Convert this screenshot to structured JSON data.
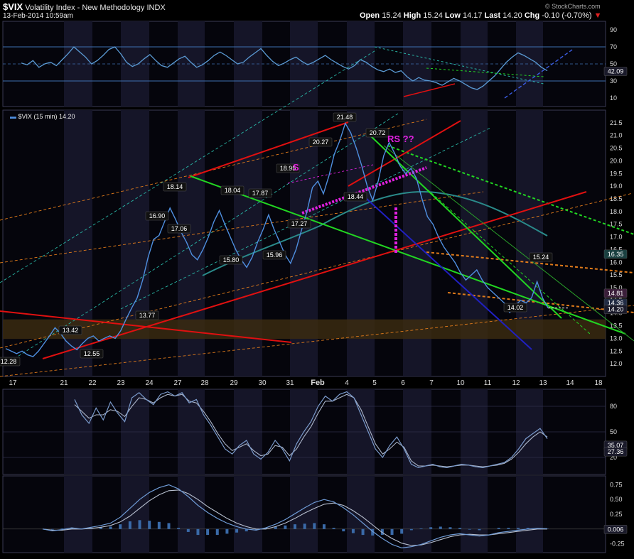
{
  "header": {
    "symbol": "$VIX",
    "name": "Volatility Index - New Methodology",
    "exchange": "INDX",
    "timestamp": "13-Feb-2014 10:59am",
    "open_label": "Open",
    "open": "15.24",
    "high_label": "High",
    "high": "15.24",
    "low_label": "Low",
    "low": "14.17",
    "last_label": "Last",
    "last": "14.20",
    "chg_label": "Chg",
    "chg": "-0.10 (-0.70%)",
    "watermark": "© StockCharts.com",
    "legend": "$VIX (15 min) 14.20"
  },
  "colors": {
    "background": "#000000",
    "panel_band": "#151528",
    "price": "#4f8fe0",
    "rsi": "#5b9bd5",
    "red_trend": "#e01010",
    "green_trend": "#22d622",
    "dash_cyan": "#29b5a5",
    "dash_orange": "#e07b1b",
    "magenta": "#e020e0",
    "blue_line": "#2020c0",
    "teal_ma": "#2a8a8a",
    "support_zone": "#3a2a10"
  },
  "chart_data": [
    {
      "type": "line",
      "panel": "RSI",
      "y_ticks": [
        "90",
        "70",
        "50",
        "30",
        "10"
      ],
      "ylim": [
        0,
        100
      ],
      "last_value_label": "42.09",
      "series": [
        {
          "values": [
            51,
            49,
            54,
            46,
            50,
            52,
            48,
            55,
            62,
            70,
            64,
            58,
            50,
            54,
            60,
            67,
            70,
            62,
            52,
            47,
            50,
            56,
            61,
            54,
            48,
            46,
            51,
            56,
            59,
            52,
            46,
            49,
            54,
            60,
            64,
            60,
            55,
            50,
            52,
            58,
            63,
            68,
            60,
            53,
            48,
            51,
            55,
            58,
            53,
            49,
            52,
            56,
            60,
            55,
            51,
            47,
            44,
            48,
            55,
            52,
            47,
            43,
            41,
            44,
            40,
            42,
            35,
            30,
            34,
            31,
            30,
            28,
            25,
            29,
            33,
            30,
            26,
            22,
            20,
            24,
            30,
            36,
            44,
            52,
            58,
            63,
            60,
            56,
            52,
            46,
            42
          ]
        }
      ]
    },
    {
      "type": "line",
      "panel": "Price",
      "title": "$VIX (15 min) 14.20",
      "ylim": [
        11.5,
        22.0
      ],
      "y_ticks": [
        "21.5",
        "21.0",
        "20.5",
        "20.0",
        "19.5",
        "19.0",
        "18.5",
        "18.0",
        "17.5",
        "17.0",
        "16.5",
        "16.0",
        "15.5",
        "15.0",
        "14.5",
        "14.0",
        "13.5",
        "13.0",
        "12.5",
        "12.0"
      ],
      "x_ticks": [
        "17",
        "21",
        "22",
        "23",
        "24",
        "27",
        "28",
        "29",
        "30",
        "31",
        "Feb",
        "4",
        "5",
        "6",
        "7",
        "10",
        "11",
        "12",
        "13",
        "14",
        "18"
      ],
      "series": [
        {
          "values": [
            12.6,
            12.5,
            12.4,
            12.5,
            12.35,
            12.28,
            12.5,
            12.8,
            13.1,
            13.42,
            13.2,
            12.9,
            12.7,
            12.55,
            12.8,
            13.0,
            13.1,
            12.9,
            13.0,
            13.1,
            13.0,
            13.3,
            13.77,
            14.2,
            14.6,
            15.3,
            16.2,
            16.9,
            17.06,
            17.6,
            18.14,
            17.7,
            17.2,
            16.8,
            16.3,
            16.1,
            16.5,
            17.0,
            17.6,
            18.04,
            17.5,
            17.0,
            16.5,
            16.1,
            15.8,
            16.2,
            16.8,
            17.3,
            17.87,
            17.3,
            16.8,
            16.3,
            15.96,
            16.5,
            17.27,
            18.0,
            18.95,
            19.2,
            18.7,
            19.4,
            20.27,
            20.8,
            21.48,
            21.1,
            20.5,
            19.8,
            19.0,
            18.44,
            19.2,
            20.2,
            20.72,
            20.3,
            19.8,
            19.5,
            19.7,
            19.3,
            18.5,
            17.8,
            17.5,
            17.0,
            16.6,
            16.3,
            16.0,
            15.6,
            15.3,
            15.5,
            15.7,
            15.3,
            15.0,
            14.8,
            14.6,
            14.4,
            14.02,
            14.3,
            14.5,
            14.4,
            14.6,
            15.24,
            14.6,
            14.2
          ]
        }
      ],
      "annotations": [
        "21.48",
        "20.72",
        "20.27",
        "18.95",
        "18.44",
        "18.14",
        "18.04",
        "17.87",
        "17.27",
        "17.06",
        "16.90",
        "15.96",
        "15.80",
        "15.24",
        "14.02",
        "13.77",
        "13.42",
        "12.55",
        "12.28",
        "RS ??",
        "S"
      ],
      "last_value_labels": [
        "14.81",
        "14.36",
        "14.20",
        "16.35"
      ]
    },
    {
      "type": "line",
      "panel": "Stochastic",
      "y_ticks": [
        "80",
        "50",
        "20"
      ],
      "ylim": [
        0,
        100
      ],
      "last_value_labels": [
        "35.07",
        "27.36"
      ],
      "series": [
        {
          "values": [
            88,
            70,
            60,
            78,
            64,
            85,
            72,
            62,
            90,
            96,
            88,
            82,
            94,
            97,
            92,
            96,
            84,
            88,
            70,
            58,
            44,
            30,
            24,
            34,
            40,
            24,
            18,
            26,
            40,
            30,
            16,
            36,
            50,
            62,
            80,
            92,
            86,
            94,
            97,
            90,
            70,
            50,
            30,
            20,
            34,
            44,
            30,
            12,
            8,
            10,
            12,
            9,
            8,
            10,
            12,
            11,
            9,
            8,
            10,
            12,
            14,
            20,
            30,
            42,
            48,
            54,
            42
          ]
        },
        {
          "values": [
            82,
            74,
            66,
            70,
            70,
            76,
            74,
            68,
            80,
            90,
            88,
            84,
            90,
            94,
            92,
            94,
            86,
            84,
            74,
            62,
            48,
            36,
            28,
            32,
            36,
            28,
            22,
            24,
            34,
            32,
            22,
            30,
            44,
            56,
            72,
            86,
            86,
            90,
            94,
            90,
            76,
            56,
            36,
            24,
            30,
            38,
            32,
            16,
            10,
            10,
            11,
            10,
            9,
            10,
            11,
            11,
            10,
            9,
            10,
            11,
            13,
            18,
            26,
            36,
            44,
            50,
            44
          ]
        }
      ]
    },
    {
      "type": "line",
      "panel": "MACD",
      "y_ticks": [
        "0.75",
        "0.50",
        "0.25",
        "-0.25"
      ],
      "ylim": [
        -0.4,
        0.9
      ],
      "last_value_label": "0.006",
      "series": [
        {
          "values": [
            0.0,
            -0.03,
            -0.01,
            0.02,
            0.0,
            0.03,
            0.06,
            0.1,
            0.2,
            0.35,
            0.5,
            0.62,
            0.7,
            0.75,
            0.68,
            0.55,
            0.4,
            0.28,
            0.18,
            0.1,
            0.04,
            0.0,
            -0.02,
            0.02,
            0.08,
            0.16,
            0.26,
            0.36,
            0.45,
            0.5,
            0.46,
            0.36,
            0.24,
            0.1,
            -0.04,
            -0.16,
            -0.26,
            -0.32,
            -0.3,
            -0.26,
            -0.2,
            -0.14,
            -0.1,
            -0.08,
            -0.1,
            -0.12,
            -0.1,
            -0.06,
            -0.04,
            -0.02,
            0.0,
            0.01,
            0.006
          ]
        },
        {
          "values": [
            0.0,
            -0.02,
            -0.02,
            0.0,
            0.0,
            0.01,
            0.03,
            0.06,
            0.12,
            0.22,
            0.35,
            0.48,
            0.58,
            0.65,
            0.66,
            0.6,
            0.5,
            0.38,
            0.28,
            0.18,
            0.1,
            0.04,
            0.0,
            0.0,
            0.04,
            0.1,
            0.18,
            0.27,
            0.35,
            0.42,
            0.44,
            0.4,
            0.31,
            0.2,
            0.07,
            -0.06,
            -0.16,
            -0.24,
            -0.28,
            -0.27,
            -0.23,
            -0.18,
            -0.13,
            -0.1,
            -0.09,
            -0.1,
            -0.1,
            -0.08,
            -0.06,
            -0.04,
            -0.02,
            0.0,
            0.0
          ]
        }
      ]
    }
  ]
}
